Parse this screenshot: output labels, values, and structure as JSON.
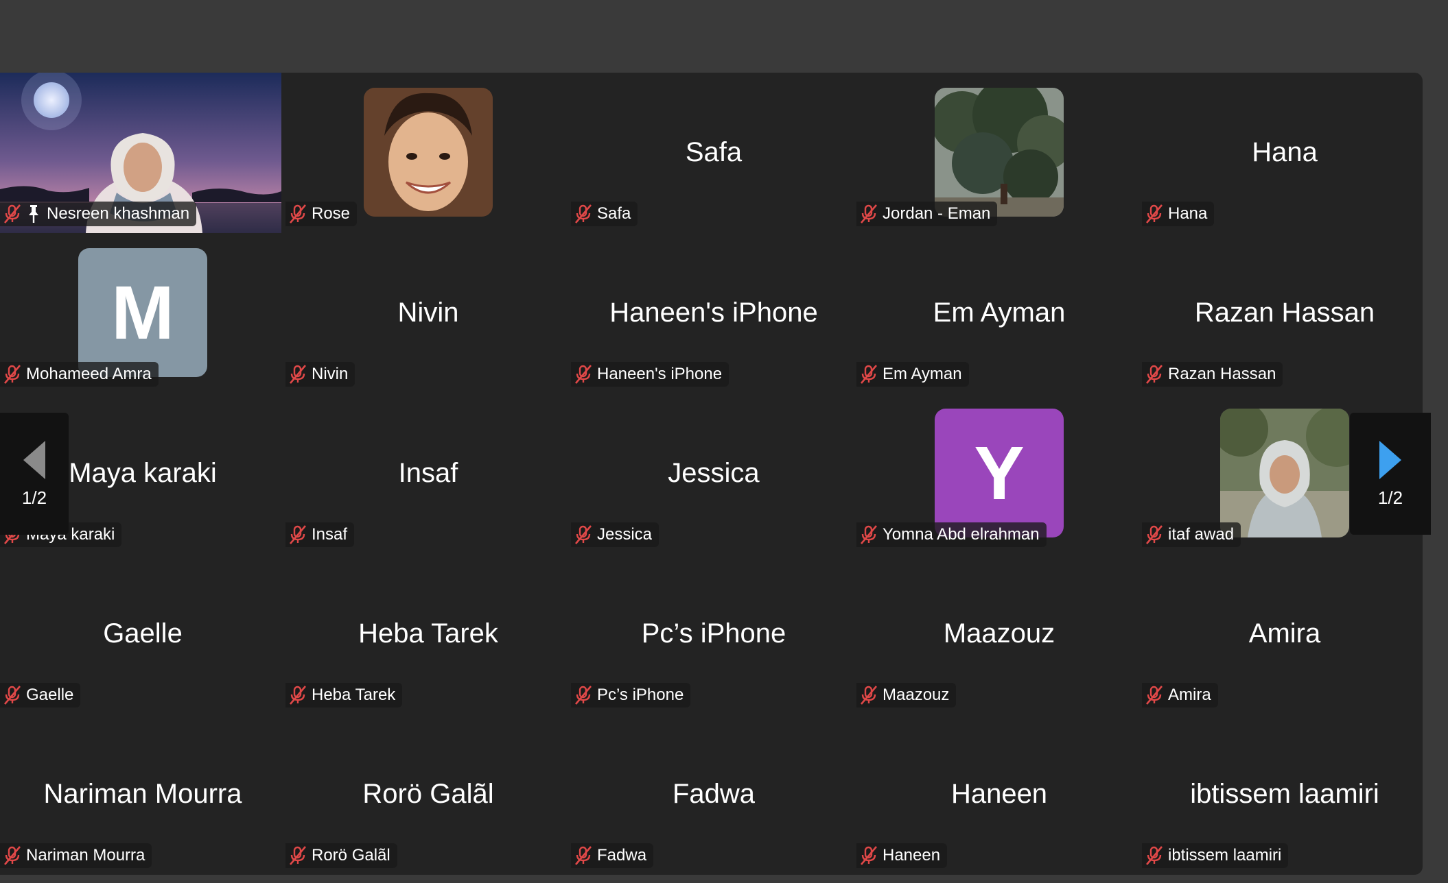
{
  "colors": {
    "background": "#3a3a3a",
    "grid": "#232323",
    "mute": "#e04848",
    "avatar_m": "#8597a4",
    "avatar_y": "#9a46bb",
    "nav_next_arrow": "#3da0ef",
    "nav_prev_arrow": "#8a8a8a"
  },
  "participants": [
    {
      "name": "Nesreen khashman",
      "kind": "video",
      "pinned": true
    },
    {
      "name": "Rose",
      "kind": "photo-rose"
    },
    {
      "display": "Safa",
      "name": "Safa",
      "kind": "text"
    },
    {
      "name": "Jordan - Eman",
      "kind": "photo-tree"
    },
    {
      "display": "Hana",
      "name": "Hana",
      "kind": "text"
    },
    {
      "letter": "M",
      "name": "Mohameed Amra",
      "kind": "letter-m",
      "offset": "left"
    },
    {
      "display": "Nivin",
      "name": "Nivin",
      "kind": "text"
    },
    {
      "display": "Haneen's iPhone",
      "name": "Haneen's iPhone",
      "kind": "text"
    },
    {
      "display": "Em Ayman",
      "name": "Em Ayman",
      "kind": "text"
    },
    {
      "display": "Razan Hassan",
      "name": "Razan Hassan",
      "kind": "text"
    },
    {
      "display": "Maya karaki",
      "name": "Maya karaki",
      "kind": "text"
    },
    {
      "display": "Insaf",
      "name": "Insaf",
      "kind": "text"
    },
    {
      "display": "Jessica",
      "name": "Jessica",
      "kind": "text"
    },
    {
      "letter": "Y",
      "name": "Yomna Abd elrahman",
      "kind": "letter-y"
    },
    {
      "name": "itaf awad",
      "kind": "photo-itaf"
    },
    {
      "display": "Gaelle",
      "name": "Gaelle",
      "kind": "text"
    },
    {
      "display": "Heba Tarek",
      "name": "Heba Tarek",
      "kind": "text"
    },
    {
      "display": "Pc’s iPhone",
      "name": "Pc’s iPhone",
      "kind": "text"
    },
    {
      "display": "Maazouz",
      "name": "Maazouz",
      "kind": "text"
    },
    {
      "display": "Amira",
      "name": "Amira",
      "kind": "text"
    },
    {
      "display": "Nariman Mourra",
      "name": "Nariman Mourra",
      "kind": "text"
    },
    {
      "display": "Rorö Galãl",
      "name": "Rorö Galãl",
      "kind": "text"
    },
    {
      "display": "Fadwa",
      "name": "Fadwa",
      "kind": "text"
    },
    {
      "display": "Haneen",
      "name": "Haneen",
      "kind": "text"
    },
    {
      "display": "ibtissem laamiri",
      "name": "ibtissem laamiri",
      "kind": "text"
    }
  ],
  "pagination": {
    "prev_label": "1/2",
    "next_label": "1/2"
  }
}
